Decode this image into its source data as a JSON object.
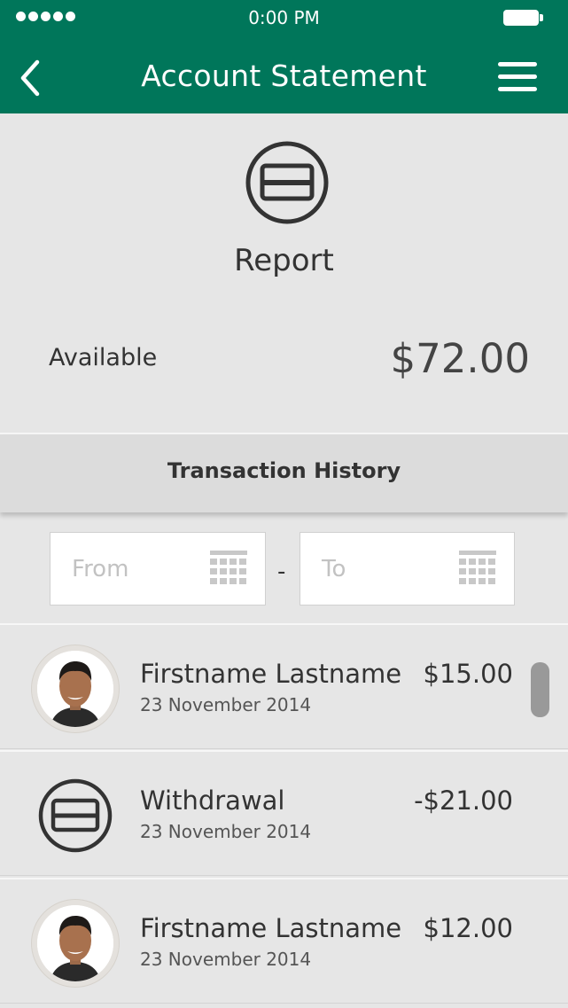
{
  "status_bar": {
    "time": "0:00 PM",
    "icons": [
      "signal-dots-icon",
      "battery-icon"
    ]
  },
  "header": {
    "title": "Account Statement",
    "back_icon": "chevron-left-icon",
    "menu_icon": "hamburger-menu-icon",
    "color": "#00765a"
  },
  "summary": {
    "icon": "card-icon",
    "heading": "Report",
    "available_label": "Available",
    "available_value": "$72.00"
  },
  "history": {
    "title": "Transaction History",
    "from_placeholder": "From",
    "to_placeholder": "To",
    "separator": "-",
    "calendar_icon": "calendar-grid-icon"
  },
  "transactions": [
    {
      "type": "person",
      "icon": "avatar",
      "name": "Firstname Lastname",
      "date": "23 November 2014",
      "amount": "$15.00"
    },
    {
      "type": "withdrawal",
      "icon": "card-icon",
      "name": "Withdrawal",
      "date": "23 November 2014",
      "amount": "-$21.00"
    },
    {
      "type": "person",
      "icon": "avatar",
      "name": "Firstname Lastname",
      "date": "23 November 2014",
      "amount": "$12.00"
    }
  ]
}
